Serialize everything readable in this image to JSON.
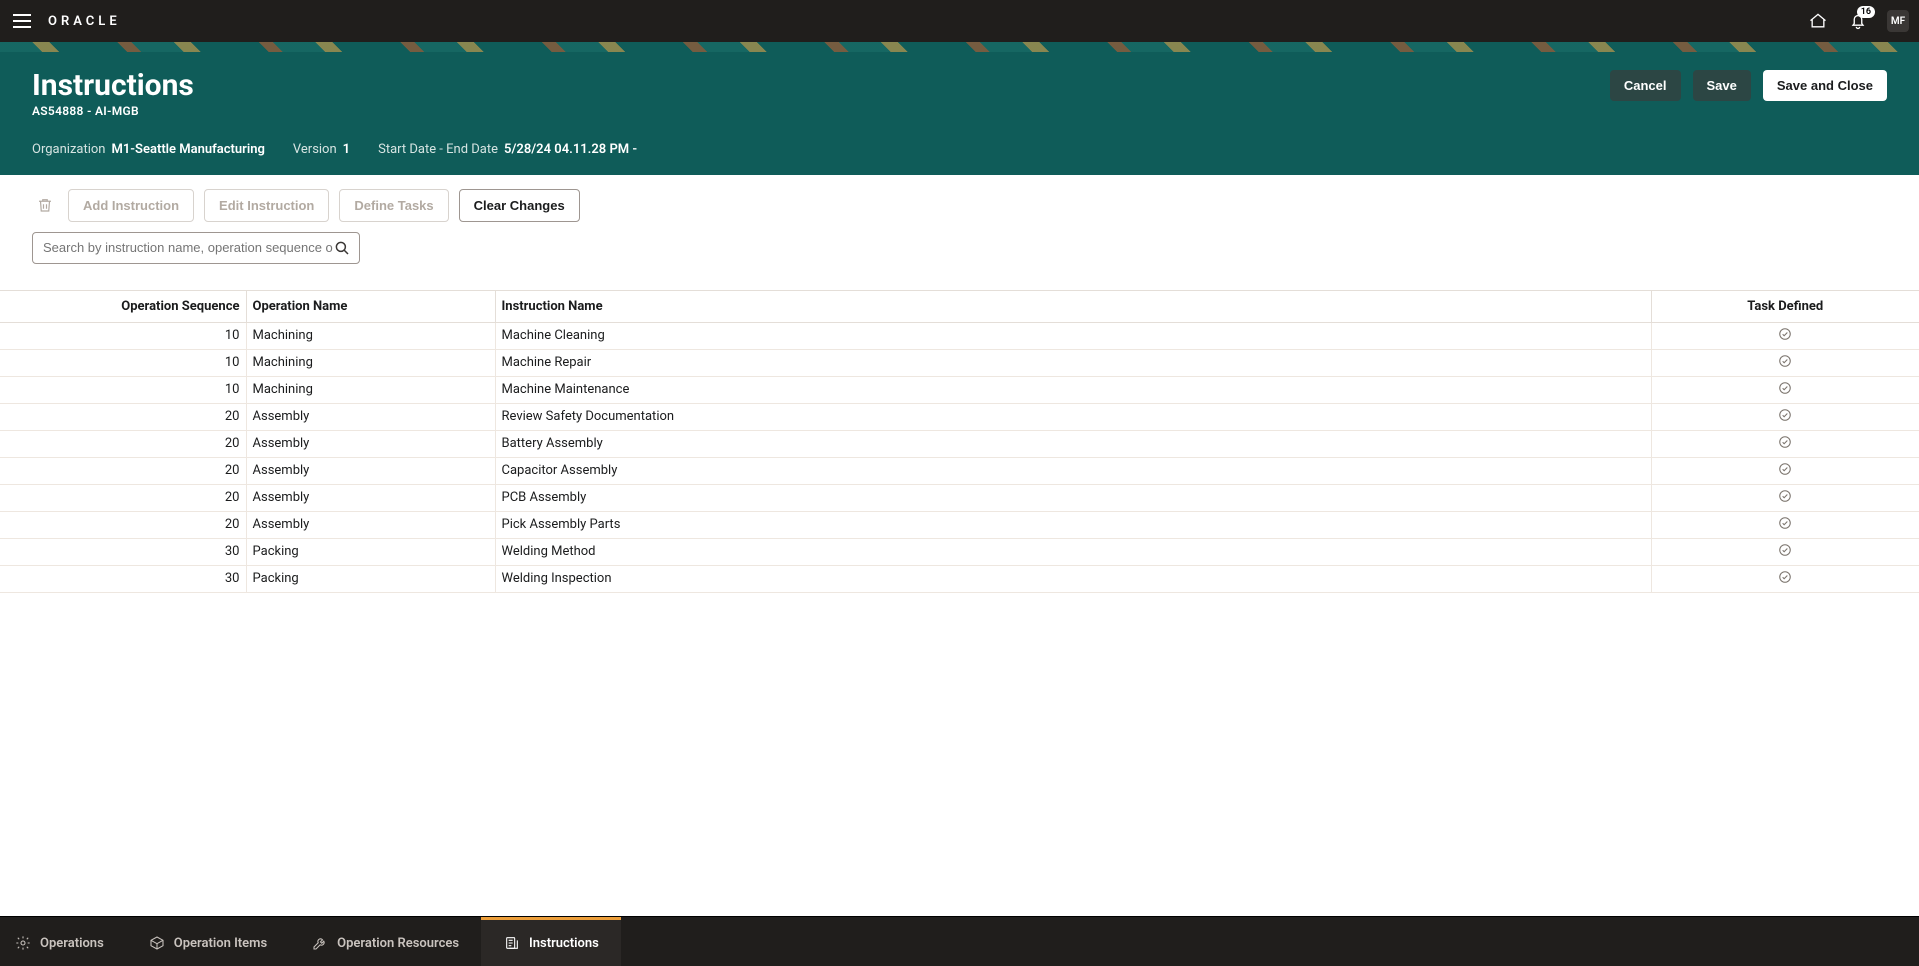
{
  "topbar": {
    "logo": "ORACLE",
    "notification_badge": "16",
    "avatar_initials": "MF"
  },
  "header": {
    "title": "Instructions",
    "subtitle": "AS54888 - AI-MGB",
    "meta": {
      "organization_label": "Organization",
      "organization_value": "M1-Seattle Manufacturing",
      "version_label": "Version",
      "version_value": "1",
      "date_label": "Start Date - End Date",
      "date_value": "5/28/24 04.11.28 PM -"
    },
    "buttons": {
      "cancel": "Cancel",
      "save": "Save",
      "save_close": "Save and Close"
    }
  },
  "toolbar": {
    "add_instruction": "Add Instruction",
    "edit_instruction": "Edit Instruction",
    "define_tasks": "Define Tasks",
    "clear_changes": "Clear Changes"
  },
  "search": {
    "placeholder": "Search by instruction name, operation sequence or operation name"
  },
  "table": {
    "columns": {
      "seq": "Operation Sequence",
      "op": "Operation Name",
      "instr": "Instruction Name",
      "task": "Task Defined"
    },
    "rows": [
      {
        "seq": "10",
        "op": "Machining",
        "instr": "Machine Cleaning"
      },
      {
        "seq": "10",
        "op": "Machining",
        "instr": "Machine Repair"
      },
      {
        "seq": "10",
        "op": "Machining",
        "instr": "Machine Maintenance"
      },
      {
        "seq": "20",
        "op": "Assembly",
        "instr": "Review Safety Documentation"
      },
      {
        "seq": "20",
        "op": "Assembly",
        "instr": "Battery Assembly"
      },
      {
        "seq": "20",
        "op": "Assembly",
        "instr": "Capacitor Assembly"
      },
      {
        "seq": "20",
        "op": "Assembly",
        "instr": "PCB Assembly"
      },
      {
        "seq": "20",
        "op": "Assembly",
        "instr": "Pick Assembly Parts"
      },
      {
        "seq": "30",
        "op": "Packing",
        "instr": "Welding Method"
      },
      {
        "seq": "30",
        "op": "Packing",
        "instr": "Welding Inspection"
      }
    ]
  },
  "bottom_nav": {
    "operations": "Operations",
    "operation_items": "Operation Items",
    "operation_resources": "Operation Resources",
    "instructions": "Instructions"
  }
}
